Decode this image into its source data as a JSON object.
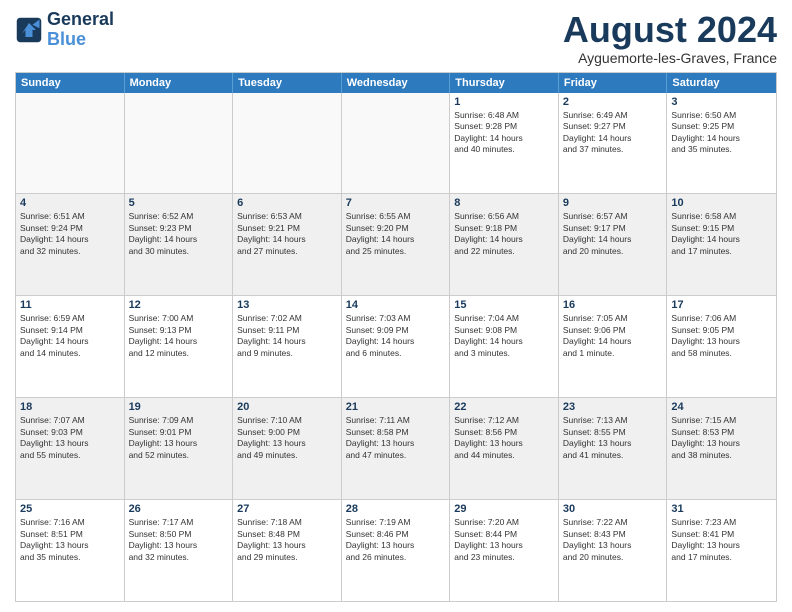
{
  "logo": {
    "line1": "General",
    "line2": "Blue"
  },
  "title": "August 2024",
  "subtitle": "Ayguemorte-les-Graves, France",
  "days": [
    "Sunday",
    "Monday",
    "Tuesday",
    "Wednesday",
    "Thursday",
    "Friday",
    "Saturday"
  ],
  "weeks": [
    [
      {
        "day": "",
        "info": ""
      },
      {
        "day": "",
        "info": ""
      },
      {
        "day": "",
        "info": ""
      },
      {
        "day": "",
        "info": ""
      },
      {
        "day": "1",
        "info": "Sunrise: 6:48 AM\nSunset: 9:28 PM\nDaylight: 14 hours\nand 40 minutes."
      },
      {
        "day": "2",
        "info": "Sunrise: 6:49 AM\nSunset: 9:27 PM\nDaylight: 14 hours\nand 37 minutes."
      },
      {
        "day": "3",
        "info": "Sunrise: 6:50 AM\nSunset: 9:25 PM\nDaylight: 14 hours\nand 35 minutes."
      }
    ],
    [
      {
        "day": "4",
        "info": "Sunrise: 6:51 AM\nSunset: 9:24 PM\nDaylight: 14 hours\nand 32 minutes."
      },
      {
        "day": "5",
        "info": "Sunrise: 6:52 AM\nSunset: 9:23 PM\nDaylight: 14 hours\nand 30 minutes."
      },
      {
        "day": "6",
        "info": "Sunrise: 6:53 AM\nSunset: 9:21 PM\nDaylight: 14 hours\nand 27 minutes."
      },
      {
        "day": "7",
        "info": "Sunrise: 6:55 AM\nSunset: 9:20 PM\nDaylight: 14 hours\nand 25 minutes."
      },
      {
        "day": "8",
        "info": "Sunrise: 6:56 AM\nSunset: 9:18 PM\nDaylight: 14 hours\nand 22 minutes."
      },
      {
        "day": "9",
        "info": "Sunrise: 6:57 AM\nSunset: 9:17 PM\nDaylight: 14 hours\nand 20 minutes."
      },
      {
        "day": "10",
        "info": "Sunrise: 6:58 AM\nSunset: 9:15 PM\nDaylight: 14 hours\nand 17 minutes."
      }
    ],
    [
      {
        "day": "11",
        "info": "Sunrise: 6:59 AM\nSunset: 9:14 PM\nDaylight: 14 hours\nand 14 minutes."
      },
      {
        "day": "12",
        "info": "Sunrise: 7:00 AM\nSunset: 9:13 PM\nDaylight: 14 hours\nand 12 minutes."
      },
      {
        "day": "13",
        "info": "Sunrise: 7:02 AM\nSunset: 9:11 PM\nDaylight: 14 hours\nand 9 minutes."
      },
      {
        "day": "14",
        "info": "Sunrise: 7:03 AM\nSunset: 9:09 PM\nDaylight: 14 hours\nand 6 minutes."
      },
      {
        "day": "15",
        "info": "Sunrise: 7:04 AM\nSunset: 9:08 PM\nDaylight: 14 hours\nand 3 minutes."
      },
      {
        "day": "16",
        "info": "Sunrise: 7:05 AM\nSunset: 9:06 PM\nDaylight: 14 hours\nand 1 minute."
      },
      {
        "day": "17",
        "info": "Sunrise: 7:06 AM\nSunset: 9:05 PM\nDaylight: 13 hours\nand 58 minutes."
      }
    ],
    [
      {
        "day": "18",
        "info": "Sunrise: 7:07 AM\nSunset: 9:03 PM\nDaylight: 13 hours\nand 55 minutes."
      },
      {
        "day": "19",
        "info": "Sunrise: 7:09 AM\nSunset: 9:01 PM\nDaylight: 13 hours\nand 52 minutes."
      },
      {
        "day": "20",
        "info": "Sunrise: 7:10 AM\nSunset: 9:00 PM\nDaylight: 13 hours\nand 49 minutes."
      },
      {
        "day": "21",
        "info": "Sunrise: 7:11 AM\nSunset: 8:58 PM\nDaylight: 13 hours\nand 47 minutes."
      },
      {
        "day": "22",
        "info": "Sunrise: 7:12 AM\nSunset: 8:56 PM\nDaylight: 13 hours\nand 44 minutes."
      },
      {
        "day": "23",
        "info": "Sunrise: 7:13 AM\nSunset: 8:55 PM\nDaylight: 13 hours\nand 41 minutes."
      },
      {
        "day": "24",
        "info": "Sunrise: 7:15 AM\nSunset: 8:53 PM\nDaylight: 13 hours\nand 38 minutes."
      }
    ],
    [
      {
        "day": "25",
        "info": "Sunrise: 7:16 AM\nSunset: 8:51 PM\nDaylight: 13 hours\nand 35 minutes."
      },
      {
        "day": "26",
        "info": "Sunrise: 7:17 AM\nSunset: 8:50 PM\nDaylight: 13 hours\nand 32 minutes."
      },
      {
        "day": "27",
        "info": "Sunrise: 7:18 AM\nSunset: 8:48 PM\nDaylight: 13 hours\nand 29 minutes."
      },
      {
        "day": "28",
        "info": "Sunrise: 7:19 AM\nSunset: 8:46 PM\nDaylight: 13 hours\nand 26 minutes."
      },
      {
        "day": "29",
        "info": "Sunrise: 7:20 AM\nSunset: 8:44 PM\nDaylight: 13 hours\nand 23 minutes."
      },
      {
        "day": "30",
        "info": "Sunrise: 7:22 AM\nSunset: 8:43 PM\nDaylight: 13 hours\nand 20 minutes."
      },
      {
        "day": "31",
        "info": "Sunrise: 7:23 AM\nSunset: 8:41 PM\nDaylight: 13 hours\nand 17 minutes."
      }
    ]
  ]
}
